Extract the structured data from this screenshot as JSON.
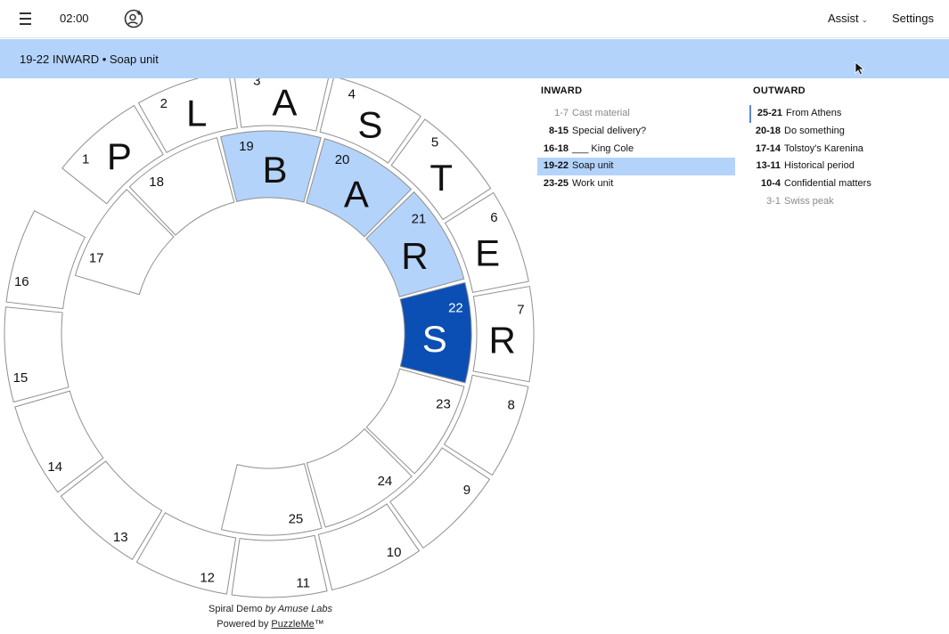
{
  "header": {
    "timer": "02:00",
    "assist_label": "Assist",
    "settings_label": "Settings"
  },
  "clue_bar": {
    "text": "19-22 INWARD • Soap unit"
  },
  "puzzle": {
    "outer_ring": [
      {
        "num": "1",
        "letter": "P"
      },
      {
        "num": "2",
        "letter": "L"
      },
      {
        "num": "3",
        "letter": "A"
      },
      {
        "num": "4",
        "letter": "S"
      },
      {
        "num": "5",
        "letter": "T"
      },
      {
        "num": "6",
        "letter": "E"
      },
      {
        "num": "7",
        "letter": "R"
      },
      {
        "num": "8",
        "letter": ""
      },
      {
        "num": "9",
        "letter": ""
      },
      {
        "num": "10",
        "letter": ""
      },
      {
        "num": "11",
        "letter": ""
      },
      {
        "num": "12",
        "letter": ""
      },
      {
        "num": "13",
        "letter": ""
      },
      {
        "num": "14",
        "letter": ""
      },
      {
        "num": "15",
        "letter": ""
      },
      {
        "num": "16",
        "letter": ""
      }
    ],
    "inner_ring": [
      {
        "num": "17",
        "letter": "",
        "state": "normal"
      },
      {
        "num": "18",
        "letter": "",
        "state": "normal"
      },
      {
        "num": "19",
        "letter": "B",
        "state": "highlight"
      },
      {
        "num": "20",
        "letter": "A",
        "state": "highlight"
      },
      {
        "num": "21",
        "letter": "R",
        "state": "highlight"
      },
      {
        "num": "22",
        "letter": "S",
        "state": "active"
      },
      {
        "num": "23",
        "letter": "",
        "state": "normal"
      },
      {
        "num": "24",
        "letter": "",
        "state": "normal"
      },
      {
        "num": "25",
        "letter": "",
        "state": "normal"
      }
    ],
    "colors": {
      "cell_fill": "#ffffff",
      "cell_stroke": "#8f8f8f",
      "highlight": "#b4d3fb",
      "active": "#0b4fb5",
      "active_text": "#ffffff",
      "text": "#111111"
    }
  },
  "inward": {
    "header": "INWARD",
    "clues": [
      {
        "num": "1-7",
        "text": "Cast material",
        "state": "done"
      },
      {
        "num": "8-15",
        "text": "Special delivery?",
        "state": "normal"
      },
      {
        "num": "16-18",
        "text": "___ King Cole",
        "state": "normal"
      },
      {
        "num": "19-22",
        "text": "Soap unit",
        "state": "active"
      },
      {
        "num": "23-25",
        "text": "Work unit",
        "state": "normal"
      }
    ]
  },
  "outward": {
    "header": "OUTWARD",
    "clues": [
      {
        "num": "25-21",
        "text": "From Athens",
        "state": "partial"
      },
      {
        "num": "20-18",
        "text": "Do something",
        "state": "normal"
      },
      {
        "num": "17-14",
        "text": "Tolstoy's Karenina",
        "state": "normal"
      },
      {
        "num": "13-11",
        "text": "Historical period",
        "state": "normal"
      },
      {
        "num": "10-4",
        "text": "Confidential matters",
        "state": "normal"
      },
      {
        "num": "3-1",
        "text": "Swiss peak",
        "state": "done"
      }
    ]
  },
  "footer": {
    "line1_prefix": "Spiral Demo",
    "line1_by": "by Amuse Labs",
    "line2_prefix": "Powered by",
    "line2_link": "PuzzleMe",
    "line2_suffix": "™"
  },
  "icons": {
    "menu": "hamburger-menu-icon",
    "profile": "add-person-icon",
    "cursor": "mouse-pointer-icon"
  }
}
